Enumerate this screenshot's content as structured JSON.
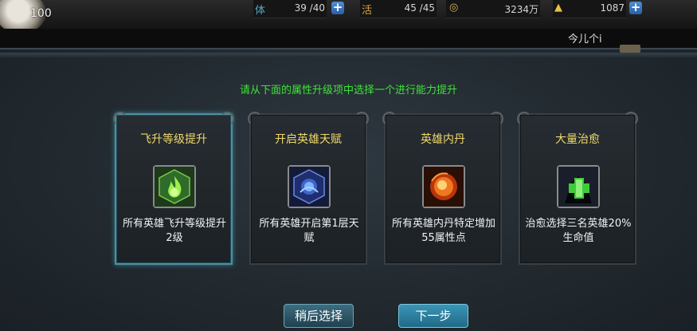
{
  "player": {
    "level": "100"
  },
  "resources": [
    {
      "icon": "stamina-icon",
      "glyph": "体",
      "value": "39 /40",
      "has_plus": true
    },
    {
      "icon": "energy-icon",
      "glyph": "活",
      "value": "45 /45",
      "has_plus": false
    },
    {
      "icon": "coin-icon",
      "glyph": "◎",
      "value": "3234万",
      "has_plus": false
    },
    {
      "icon": "gold-ingot-icon",
      "glyph": "▲",
      "value": "1087",
      "has_plus": true
    }
  ],
  "subbar": {
    "text": "今儿个i"
  },
  "instruction": "请从下面的属性升级项中选择一个进行能力提升",
  "cards": [
    {
      "title": "飞升等级提升",
      "icon": "green-flame-icon",
      "desc": "所有英雄飞升等级提升2级",
      "selected": true
    },
    {
      "title": "开启英雄天赋",
      "icon": "blue-lotus-icon",
      "desc": "所有英雄开启第1层天赋",
      "selected": false
    },
    {
      "title": "英雄内丹",
      "icon": "fire-orb-icon",
      "desc": "所有英雄内丹特定增加55属性点",
      "selected": false
    },
    {
      "title": "大量治愈",
      "icon": "heal-cross-icon",
      "desc": "治愈选择三名英雄20%生命值",
      "selected": false
    }
  ],
  "buttons": {
    "later": "稍后选择",
    "next": "下一步"
  },
  "colors": {
    "instruction": "#3fe23a",
    "card_title": "#f0d96a",
    "selected_border": "#4d8fa0"
  }
}
